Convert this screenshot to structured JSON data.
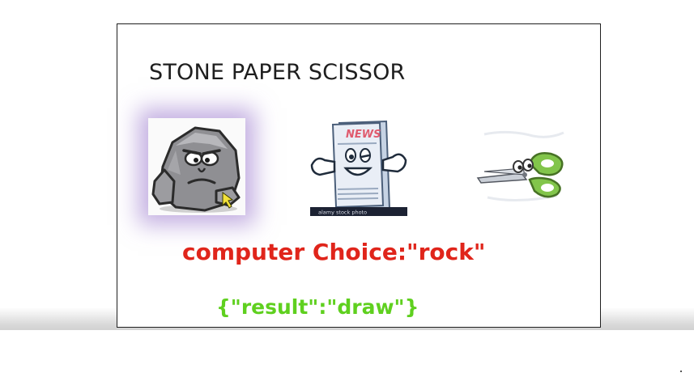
{
  "game": {
    "title": "STONE PAPER SCISSOR",
    "choices": [
      {
        "id": "rock",
        "selected": true
      },
      {
        "id": "paper",
        "selected": false,
        "caption_text": "NEWS",
        "watermark": "alamy stock photo"
      },
      {
        "id": "scissor",
        "selected": false
      }
    ],
    "computer_choice_text": "computer Choice:\"rock\"",
    "result_text": "{\"result\":\"draw\"}"
  },
  "colors": {
    "computer_choice": "#e0251b",
    "result": "#5fd01f",
    "selection_glow": "#916ec8"
  },
  "icons": [
    "rock-cartoon-icon",
    "newspaper-cartoon-icon",
    "scissors-cartoon-icon"
  ]
}
